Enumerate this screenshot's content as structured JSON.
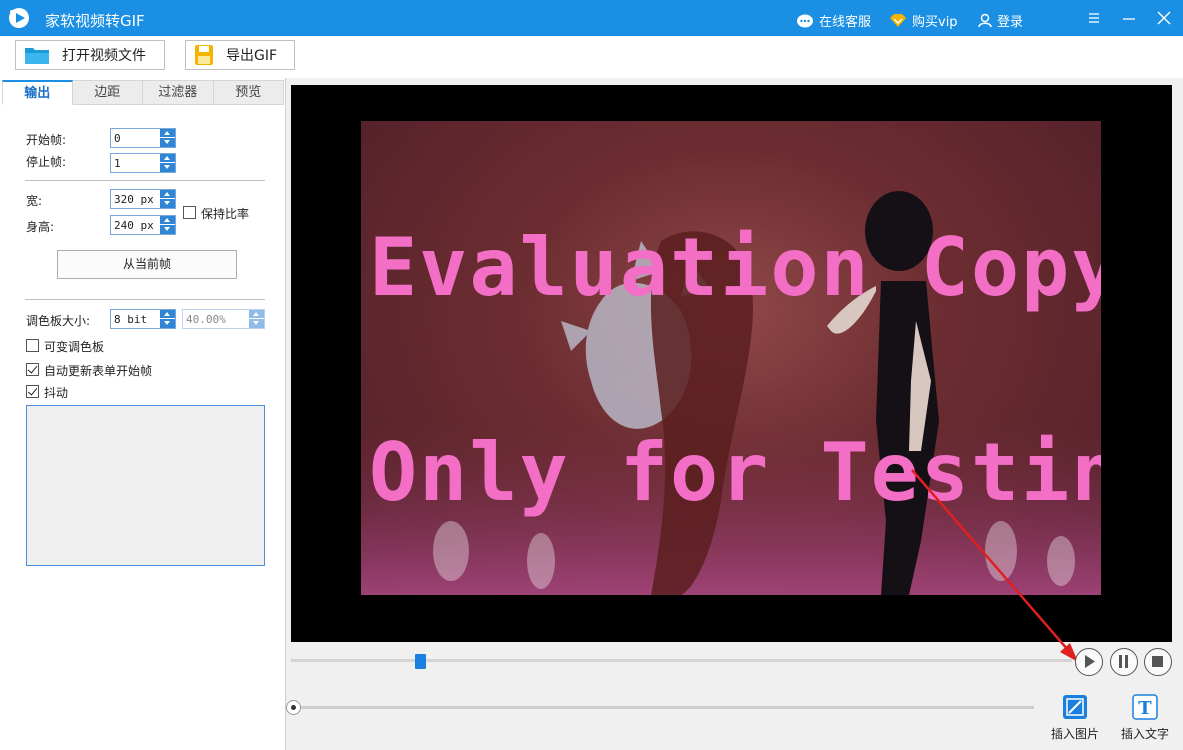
{
  "titlebar": {
    "app_title": "家软视频转GIF",
    "online_service": "在线客服",
    "buy_vip": "购买vip",
    "login": "登录"
  },
  "toolbar": {
    "open_video": "打开视频文件",
    "export_gif": "导出GIF"
  },
  "tabs": [
    "输出",
    "边距",
    "过滤器",
    "预览"
  ],
  "output": {
    "start_frame_label": "开始帧:",
    "start_frame_value": "0",
    "stop_frame_label": "停止帧:",
    "stop_frame_value": "1",
    "width_label": "宽:",
    "width_value": "320 px",
    "height_label": "身高:",
    "height_value": "240 px",
    "keep_ratio_label": "保持比率",
    "keep_ratio_checked": false,
    "from_current_frame": "从当前帧",
    "palette_size_label": "调色板大小:",
    "palette_bits_value": "8 bit",
    "palette_percent_value": "40.00%",
    "variable_palette_label": "可变调色板",
    "variable_palette_checked": false,
    "auto_update_label": "自动更新表单开始帧",
    "auto_update_checked": true,
    "dither_label": "抖动",
    "dither_checked": true
  },
  "video": {
    "watermark_line1": "Evaluation Copy",
    "watermark_line2": "Only for Testing"
  },
  "playback": {
    "progress": 0.165
  },
  "insert": {
    "image_label": "插入图片",
    "text_label": "插入文字"
  },
  "colors": {
    "accent": "#1a8fe3",
    "watermark": "#f26fc5",
    "annotation_arrow": "#e02020"
  }
}
